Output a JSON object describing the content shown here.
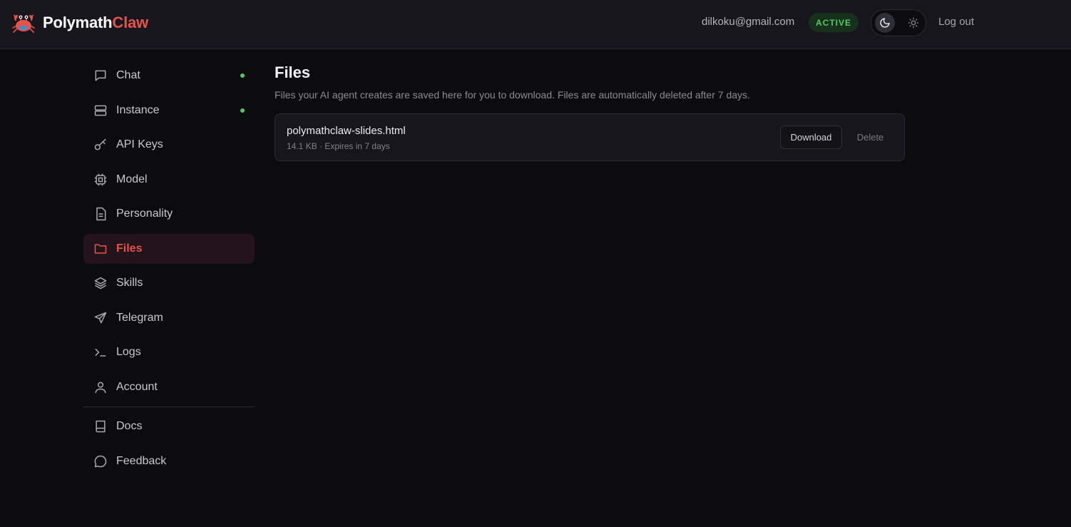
{
  "brand": {
    "name_primary": "Polymath",
    "name_accent": "Claw",
    "logo_icon": "crab-icon"
  },
  "header": {
    "email": "dilkoku@gmail.com",
    "status": "ACTIVE",
    "theme_mode": "dark",
    "logout_label": "Log out"
  },
  "sidebar": {
    "items": [
      {
        "label": "Chat",
        "icon": "chat-bubble-icon",
        "online": true
      },
      {
        "label": "Instance",
        "icon": "server-icon",
        "online": true
      },
      {
        "label": "API Keys",
        "icon": "key-icon"
      },
      {
        "label": "Model",
        "icon": "cpu-chip-icon"
      },
      {
        "label": "Personality",
        "icon": "document-icon"
      },
      {
        "label": "Files",
        "icon": "folder-icon",
        "active": true
      },
      {
        "label": "Skills",
        "icon": "layers-icon"
      },
      {
        "label": "Telegram",
        "icon": "send-icon"
      },
      {
        "label": "Logs",
        "icon": "terminal-icon"
      },
      {
        "label": "Account",
        "icon": "user-icon"
      }
    ],
    "footer_items": [
      {
        "label": "Docs",
        "icon": "book-icon"
      },
      {
        "label": "Feedback",
        "icon": "message-circle-icon"
      }
    ]
  },
  "main": {
    "title": "Files",
    "description": "Files your AI agent creates are saved here for you to download. Files are automatically deleted after 7 days.",
    "files": [
      {
        "name": "polymathclaw-slides.html",
        "meta": "14.1 KB · Expires in 7 days",
        "download_label": "Download",
        "delete_label": "Delete"
      }
    ]
  },
  "colors": {
    "accent": "#e5534b",
    "status_green": "#4ecb63",
    "background": "#0c0c0f",
    "surface": "#16161c"
  }
}
